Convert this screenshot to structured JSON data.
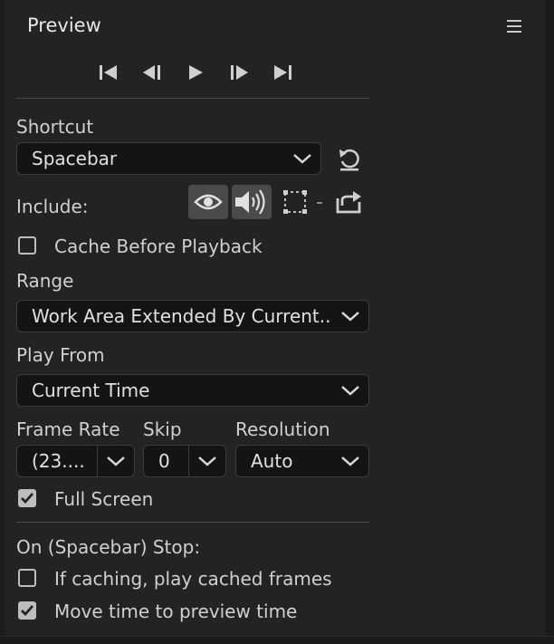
{
  "panel": {
    "title": "Preview"
  },
  "transport": {
    "buttons": [
      "first-frame",
      "previous-frame",
      "play",
      "next-frame",
      "last-frame"
    ]
  },
  "shortcut": {
    "label": "Shortcut",
    "value": "Spacebar"
  },
  "include": {
    "label": "Include:",
    "video_active": true,
    "audio_active": true
  },
  "cache_before_playback": {
    "label": "Cache Before Playback",
    "checked": false
  },
  "range": {
    "label": "Range",
    "value": "Work Area Extended By Current..."
  },
  "play_from": {
    "label": "Play From",
    "value": "Current Time"
  },
  "frame_rate": {
    "label": "Frame Rate",
    "value": "(23...."
  },
  "skip": {
    "label": "Skip",
    "value": "0"
  },
  "resolution": {
    "label": "Resolution",
    "value": "Auto"
  },
  "full_screen": {
    "label": "Full Screen",
    "checked": true
  },
  "on_stop": {
    "label": "On (Spacebar) Stop:",
    "if_caching": {
      "label": "If caching, play cached frames",
      "checked": false
    },
    "move_time": {
      "label": "Move time to preview time",
      "checked": true
    }
  },
  "colors": {
    "panel_bg": "#232323",
    "field_bg": "#141414",
    "active_btn": "#4a4a4a",
    "text": "#d0d0d0"
  }
}
